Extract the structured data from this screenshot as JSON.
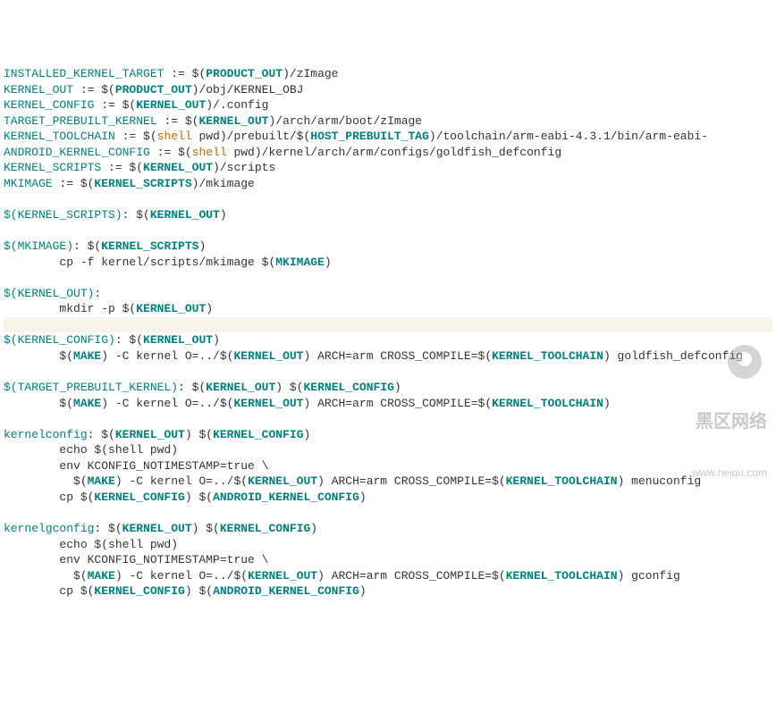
{
  "vars": {
    "installed_kernel_target": "INSTALLED_KERNEL_TARGET",
    "kernel_out": "KERNEL_OUT",
    "kernel_config": "KERNEL_CONFIG",
    "target_prebuilt_kernel": "TARGET_PREBUILT_KERNEL",
    "kernel_toolchain": "KERNEL_TOOLCHAIN",
    "android_kernel_config": "ANDROID_KERNEL_CONFIG",
    "kernel_scripts": "KERNEL_SCRIPTS",
    "mkimage": "MKIMAGE",
    "product_out": "PRODUCT_OUT",
    "host_prebuilt_tag": "HOST_PREBUILT_TAG",
    "make": "MAKE"
  },
  "shell": "shell",
  "paths": {
    "zimage": "/zImage",
    "obj_kernel": "/obj/KERNEL_OBJ",
    "config": "/.config",
    "arch_boot": "/arch/arm/boot/zImage",
    "prebuilt": " pwd)/prebuilt/$(",
    "toolchain_suffix": ")/toolchain/arm-eabi-4.3.1/bin/arm-eabi-",
    "goldfish": " pwd)/kernel/arch/arm/configs/goldfish_defconfig",
    "scripts": "/scripts",
    "mkimage_path": "/mkimage"
  },
  "cmds": {
    "cp_mkimage": "        cp -f kernel/scripts/mkimage $(",
    "mkdir": "        mkdir -p $(",
    "make_kernel_pre": ") -C kernel O=../$(",
    "arch_cross": ") ARCH=arm CROSS_COMPILE=$(",
    "goldfish_defconfig": ") goldfish_defconfig",
    "echo_pwd": "        echo $(shell pwd)",
    "env_kconfig": "        env KCONFIG_NOTIMESTAMP=true \\",
    "make_indent": "          $(",
    "menuconfig": ") menuconfig",
    "gconfig": ") gconfig",
    "cp_config": "        cp $("
  },
  "targets": {
    "kernelconfig": "kernelconfig",
    "kernelgconfig": "kernelgconfig"
  },
  "watermark": {
    "title": "黑区网络",
    "url": "www.heiqu.com"
  }
}
